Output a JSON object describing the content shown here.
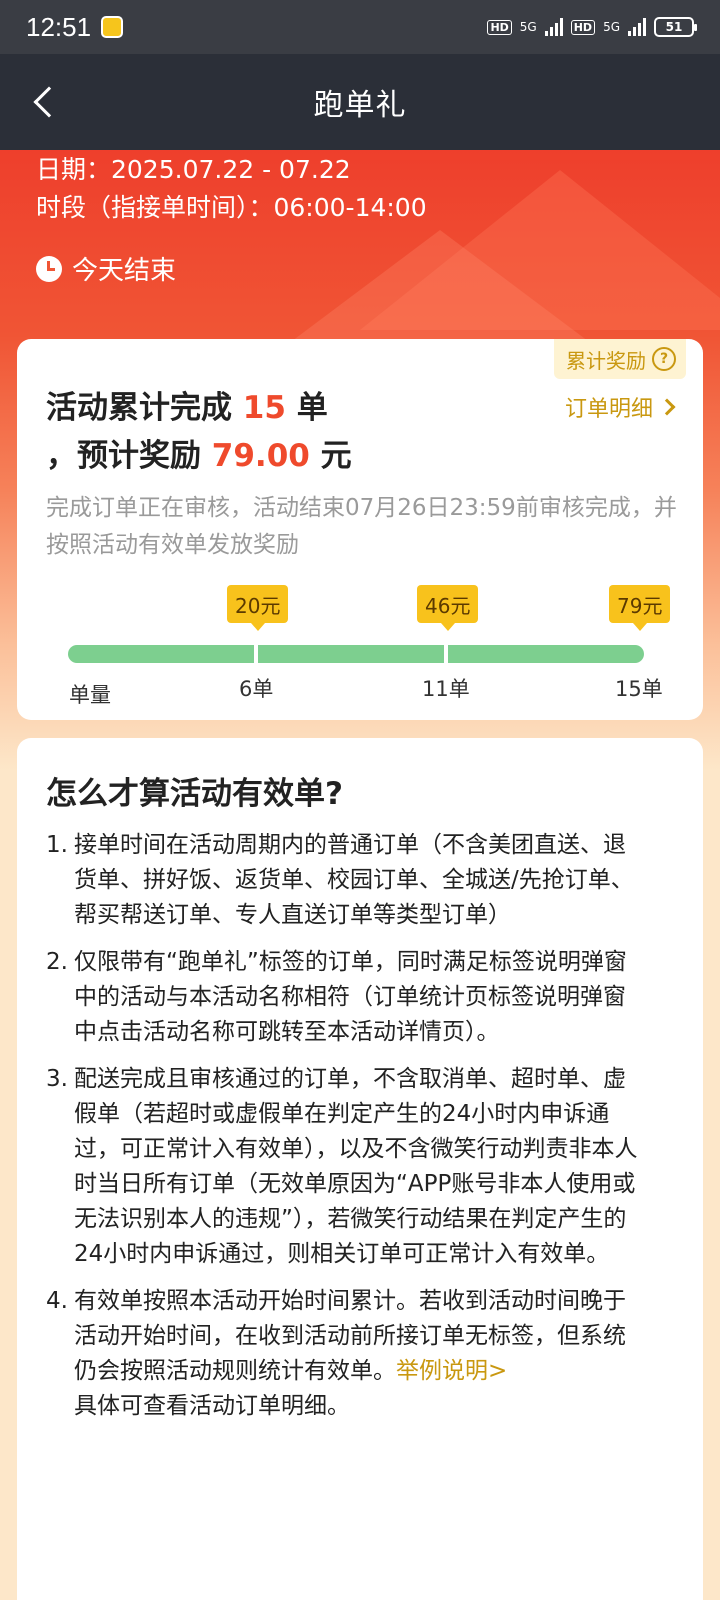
{
  "status_bar": {
    "time": "12:51",
    "network1": "HD",
    "net_type1": "5G",
    "network2": "HD",
    "net_type2": "5G",
    "battery": "51"
  },
  "header": {
    "title": "跑单礼"
  },
  "hero": {
    "date": "日期：2025.07.22 - 07.22",
    "period": "时段（指接单时间）：06:00-14:00",
    "ends": "今天结束"
  },
  "progress_card": {
    "reward_tag": "累计奖励",
    "summary_prefix": "活动累计完成 ",
    "completed_count": "15",
    "summary_mid": " 单",
    "summary_line2_prefix": "，预计奖励 ",
    "reward_amount": "79.00",
    "summary_suffix": " 元",
    "order_detail_link": "订单明细",
    "note": "完成订单正在审核，活动结束07月26日23:59前审核完成，并按照活动有效单发放奖励",
    "track_label": "单量",
    "milestones": [
      {
        "reward": "20元",
        "orders": "6单"
      },
      {
        "reward": "46元",
        "orders": "11单"
      },
      {
        "reward": "79元",
        "orders": "15单"
      }
    ],
    "progress_fraction": 1.0
  },
  "rules_card": {
    "title": "怎么才算活动有效单?",
    "rules": [
      {
        "num": "1.",
        "text": "接单时间在活动周期内的普通订单（不含美团直送、退货单、拼好饭、返货单、校园订单、全城送/先抢订单、帮买帮送订单、专人直送订单等类型订单）"
      },
      {
        "num": "2.",
        "text": "仅限带有“跑单礼”标签的订单，同时满足标签说明弹窗中的活动与本活动名称相符（订单统计页标签说明弹窗中点击活动名称可跳转至本活动详情页）。"
      },
      {
        "num": "3.",
        "text": "配送完成且审核通过的订单，不含取消单、超时单、虚假单（若超时或虚假单在判定产生的24小时内申诉通过，可正常计入有效单），以及不含微笑行动判责非本人时当日所有订单（无效单原因为“APP账号非本人使用或无法识别本人的违规”），若微笑行动结果在判定产生的24小时内申诉通过，则相关订单可正常计入有效单。"
      },
      {
        "num": "4.",
        "text": "有效单按照本活动开始时间累计。若收到活动时间晚于活动开始时间，在收到活动前所接订单无标签，但系统仍会按照活动规则统计有效单。",
        "link": "举例说明>",
        "extra": "具体可查看活动订单明细。"
      }
    ]
  },
  "colors": {
    "accent_red": "#ef4a2c",
    "accent_gold": "#c99810",
    "progress_green": "#7dcf8f",
    "milestone_yellow": "#f8c21c"
  }
}
